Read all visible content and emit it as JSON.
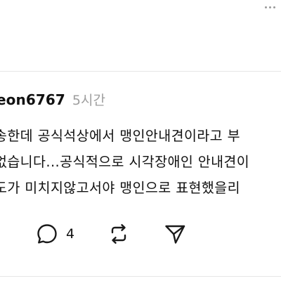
{
  "comment": {
    "username": "eon6767",
    "timestamp": "5시간",
    "lines": [
      "송한데 공식석상에서 맹인안내견이라고 부",
      "없습니다...공식적으로 시각장애인 안내견이",
      "도가 미치지않고서야 맹인으로 표현했을리"
    ]
  },
  "actions": {
    "comment_icon": "speech-bubble-icon",
    "comment_count": "4",
    "repost_icon": "repost-icon",
    "share_icon": "send-icon"
  },
  "top_menu_icon": "more-options-icon"
}
